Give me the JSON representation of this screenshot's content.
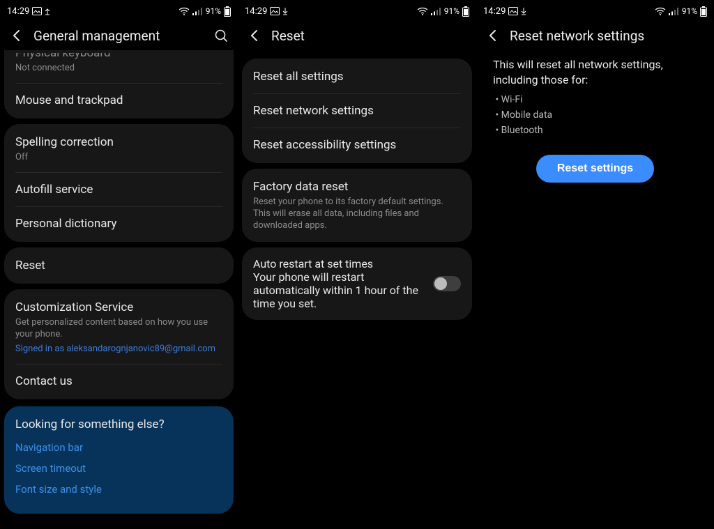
{
  "status": {
    "time": "14:29",
    "battery": "91%"
  },
  "panel1": {
    "title": "General management",
    "physical_keyboard": {
      "title": "Physical keyboard",
      "sub": "Not connected"
    },
    "mouse_trackpad": "Mouse and trackpad",
    "spelling": {
      "title": "Spelling correction",
      "sub": "Off"
    },
    "autofill": "Autofill service",
    "dictionary": "Personal dictionary",
    "reset": "Reset",
    "customization": {
      "title": "Customization Service",
      "sub": "Get personalized content based on how you use your phone.",
      "link": "Signed in as aleksandarognjanovic89@gmail.com"
    },
    "contact": "Contact us",
    "suggest": {
      "heading": "Looking for something else?",
      "navbar": "Navigation bar",
      "timeout": "Screen timeout",
      "font": "Font size and style"
    }
  },
  "panel2": {
    "title": "Reset",
    "reset_all": "Reset all settings",
    "reset_network": "Reset network settings",
    "reset_a11y": "Reset accessibility settings",
    "factory": {
      "title": "Factory data reset",
      "sub": "Reset your phone to its factory default settings. This will erase all data, including files and downloaded apps."
    },
    "auto_restart": {
      "title": "Auto restart at set times",
      "sub": "Your phone will restart automatically within 1 hour of the time you set."
    }
  },
  "panel3": {
    "title": "Reset network settings",
    "body_intro": "This will reset all network settings, including those for:",
    "bullets": {
      "wifi": "Wi-Fi",
      "mobile": "Mobile data",
      "bt": "Bluetooth"
    },
    "button": "Reset settings"
  }
}
